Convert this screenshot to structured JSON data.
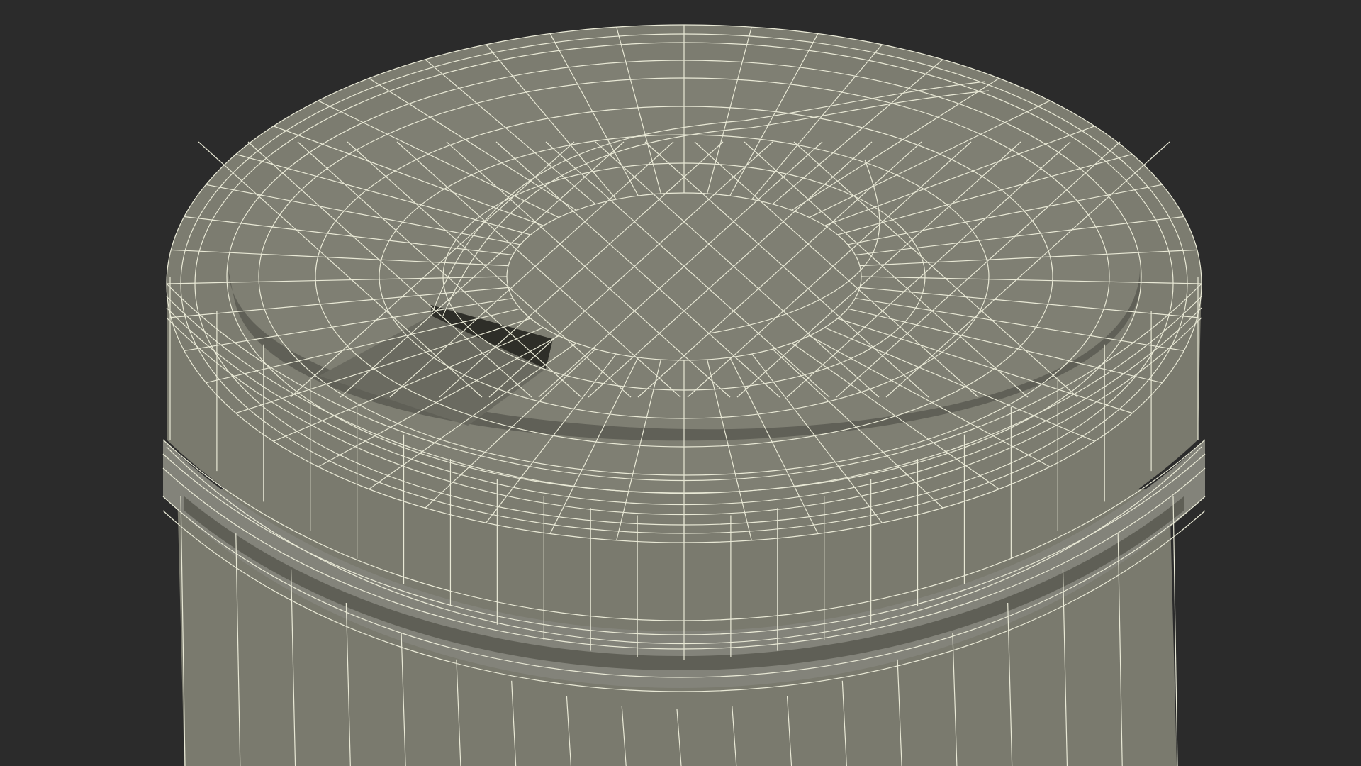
{
  "scene": {
    "subject": "wireframe-cylindrical-container-with-flip-lid",
    "colors": {
      "background": "#2b2b2b",
      "surface": "#7a7a6e",
      "surface_light": "#85857a",
      "surface_dark": "#5d5d54",
      "shadow": "#2a2a24",
      "wire": "#e9e9d6"
    }
  }
}
